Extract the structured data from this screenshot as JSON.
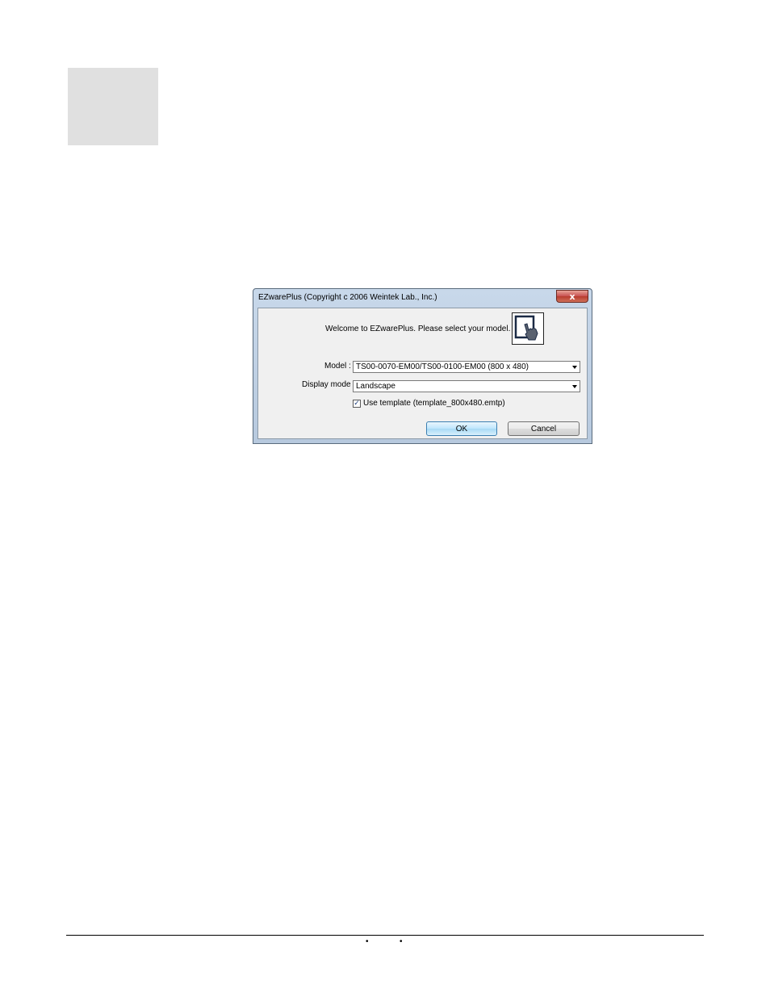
{
  "dialog": {
    "title": "EZwarePlus (Copyright c 2006  Weintek Lab., Inc.)",
    "close_glyph": "x",
    "welcome_text": "Welcome to EZwarePlus. Please select your model.",
    "model_label": "Model :",
    "model_value": "TS00-0070-EM00/TS00-0100-EM00 (800 x 480)",
    "display_mode_label": "Display mode :",
    "display_mode_value": "Landscape",
    "use_template_checked": true,
    "use_template_label": "Use template (template_800x480.emtp)",
    "ok_label": "OK",
    "cancel_label": "Cancel",
    "icon": "touch-panel-hand-icon"
  },
  "footer": {
    "bullet_1": "•",
    "bullet_2": "•"
  }
}
